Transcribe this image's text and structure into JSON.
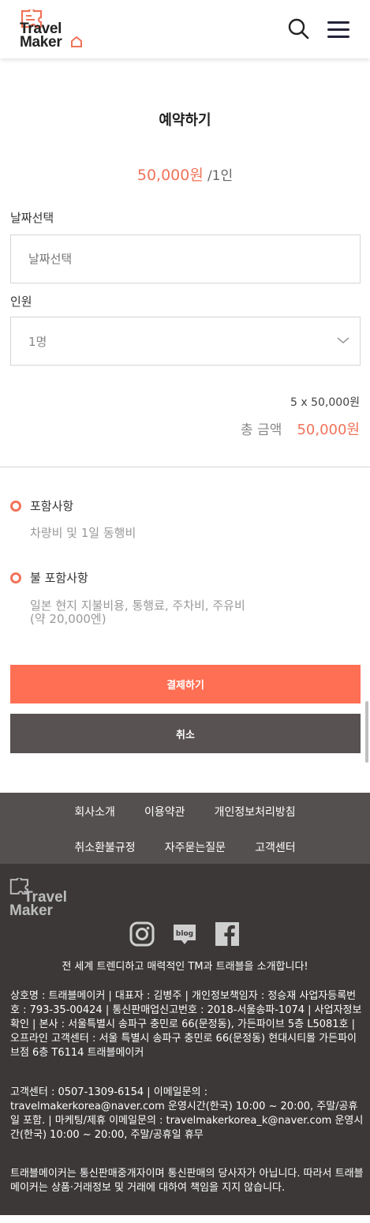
{
  "header": {
    "logo_text_line1": "Travel",
    "logo_text_line2": "Maker",
    "accent_color": "#f0735a"
  },
  "booking": {
    "title": "예약하기",
    "price": "50,000원",
    "per_person": "/1인",
    "date_label": "날짜선택",
    "date_placeholder": "날짜선택",
    "people_label": "인원",
    "people_value": "1명",
    "calc_line": "5 x 50,000원",
    "total_label": "총 금액",
    "total_value": "50,000원"
  },
  "info": {
    "included_title": "포함사항",
    "included_text": "차량비 및 1일 동행비",
    "excluded_title": "불 포함사항",
    "excluded_text": "일본 현지 지불비용, 통행료, 주차비, 주유비 (약 20,000엔)"
  },
  "actions": {
    "pay_label": "결제하기",
    "cancel_label": "취소",
    "pay_color": "#ff6f54",
    "cancel_color": "#585252"
  },
  "footer_nav": {
    "row1": [
      "회사소개",
      "이용약관",
      "개인정보처리방침"
    ],
    "row2": [
      "취소환불규정",
      "자주묻는질문",
      "고객센터"
    ]
  },
  "footer": {
    "logo_text_line1": "Travel",
    "logo_text_line2": "Maker",
    "social_icons": [
      "instagram-icon",
      "blog-icon",
      "facebook-icon"
    ],
    "blog_text": "blog",
    "slogan": "전 세계 트렌디하고 매력적인 TM과 트래블을 소개합니다!",
    "company_info": "상호명 : 트래블메이커 | 대표자 : 김병주 | 개인정보책임자 : 정승재 사업자등록번호 : 793-35-00424 | 통신판매업신고번호 : 2018-서울송파-1074 | 사업자정보확인 | 본사 : 서울특별시 송파구 충민로 66(문정동), 가든파이브 5층 L5081호 | 오프라인 고객센터 : 서울 특별시 송파구 충민로 66(문정동) 현대시티몰 가든파이브점 6층 T6114 트래블메이커",
    "contact_info": "고객센터 : 0507-1309-6154 | 이메일문의 : travelmakerkorea@naver.com 운영시간(한국) 10:00 ~ 20:00, 주말/공휴일 포함. | 마케팅/제휴 이메일문의 : travelmakerkorea_k@naver.com 운영시간(한국) 10:00 ~ 20:00, 주말/공휴일 휴무",
    "disclaimer": "트래블메이커는 통신판매중개자이며 통신판매의 당사자가 아닙니다. 따라서 트래블메이커는 상품·거래정보 및 거래에 대하여 책임을 지지 않습니다."
  }
}
